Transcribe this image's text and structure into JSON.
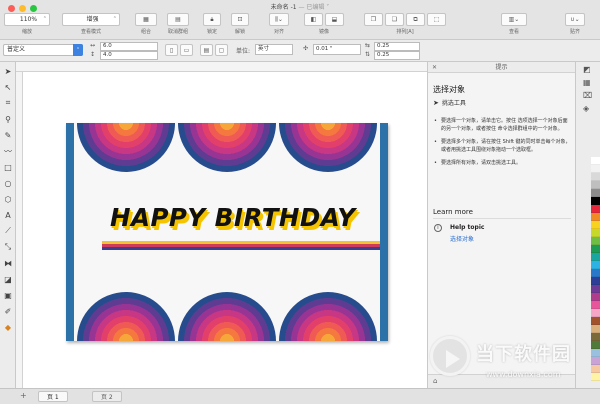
{
  "window": {
    "title": "未命名 -1",
    "subtitle": "— 已编辑 ˅",
    "colors": {
      "close": "#fc5e57",
      "minimize": "#fdbb2e",
      "maximize": "#27c840"
    }
  },
  "toolbar": {
    "zoom": {
      "value": "110%",
      "label": "缩放"
    },
    "view_mode": {
      "value": "增强",
      "label": "查看模式"
    },
    "group_label": "组合",
    "ungroup_label": "取消群组",
    "lock_label": "锁定",
    "unlock_label": "解锁",
    "align_label": "对齐",
    "mirror_label": "镜像",
    "arrange_label": "排列[A]",
    "view_label": "查看",
    "snap_label": "贴齐"
  },
  "property_bar": {
    "page_preset": "普定义",
    "width": "6.0",
    "height": "4.0",
    "units_label": "单位:",
    "units_value": "英寸",
    "nudge_value": "0.01 \"",
    "dup_x": "0.25",
    "dup_y": "0.25"
  },
  "card": {
    "text": "HAPPY  BIRTHDAY",
    "colors": {
      "border": "#2c71a8",
      "shadow_text": "#f5c400",
      "stripes": [
        "#f2c230",
        "#cf3b5a",
        "#3a3f8f"
      ]
    }
  },
  "hints_panel": {
    "header": "提示",
    "title": "选择对象",
    "tool_name": "挑选工具",
    "bullets": [
      "要选择一个对象，请单击它。按住 选项选择一个对象后面的另一个对象，或者按住 命令选择群组中的一个对象。",
      "要选择多个对象，请在按住 Shift 键的同时单击每个对象，或者用挑选工具围绕对象拖动一个选取框。",
      "要选择所有对象，请双击挑选工具。"
    ],
    "learn_more": "Learn more",
    "help_topic_title": "Help topic",
    "help_topic_link": "选择对象"
  },
  "page_tabs": [
    "页 1",
    "页 2"
  ],
  "palette": [
    "#ffffff",
    "#f2f2f2",
    "#d9d9d9",
    "#bfbfbf",
    "#8c8c8c",
    "#000000",
    "#e6263b",
    "#f08a24",
    "#f7d21e",
    "#c6d92b",
    "#6fbe44",
    "#1d9a53",
    "#1aa6a0",
    "#2bb3e6",
    "#2a78c9",
    "#2c3e98",
    "#6d3a96",
    "#b03c8c",
    "#e8559a",
    "#f6a6c5",
    "#a0522d",
    "#d9b07c",
    "#7a6a3a",
    "#4f7a3a",
    "#9ac0e0",
    "#c9a2d6",
    "#f7c9a0",
    "#fff3a6"
  ],
  "watermark": {
    "title": "当下软件园",
    "url": "www.downxia.com"
  }
}
